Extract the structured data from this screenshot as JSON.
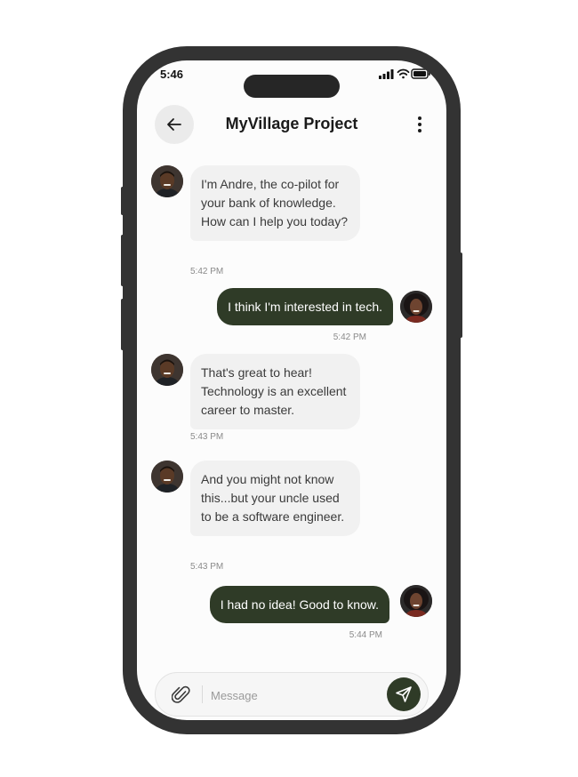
{
  "status_bar": {
    "time": "5:46"
  },
  "header": {
    "title": "MyVillage Project"
  },
  "messages": [
    {
      "sender": "Andre",
      "text": "I'm Andre, the co-pilot for your bank of knowledge. How can I help you today?",
      "time": "5:42 PM"
    },
    {
      "sender": "user",
      "text": "I think I'm interested in tech.",
      "time": "5:42 PM"
    },
    {
      "sender": "Andre",
      "text": "That's great to hear! Technology is an excellent career to master.",
      "time": "5:43 PM"
    },
    {
      "sender": "Andre",
      "text": "And you might not know this...but your uncle used to be a software engineer.",
      "time": "5:43 PM"
    },
    {
      "sender": "user",
      "text": "I had no idea!  Good to know.",
      "time": "5:44 PM"
    }
  ],
  "composer": {
    "placeholder": "Message",
    "value": ""
  },
  "colors": {
    "accent": "#2f3b27",
    "incoming_bubble": "#f1f1f1",
    "frame": "#333333"
  },
  "icons": [
    "back-arrow-icon",
    "more-vertical-icon",
    "paperclip-icon",
    "send-icon",
    "signal-icon",
    "wifi-icon",
    "battery-icon"
  ]
}
